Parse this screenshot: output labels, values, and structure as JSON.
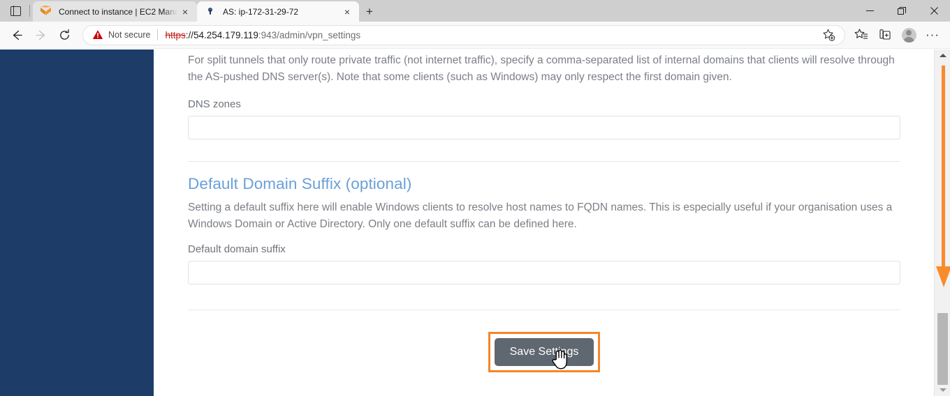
{
  "browser": {
    "tablist_icon": "tab-list-icon",
    "tabs": [
      {
        "favicon": "aws-cube-icon",
        "title": "Connect to instance | EC2 Manag",
        "close_label": "×",
        "active": false
      },
      {
        "favicon": "openvpn-icon",
        "title": "AS: ip-172-31-29-72",
        "close_label": "×",
        "active": true
      }
    ],
    "newtab_label": "+",
    "window_controls": {
      "minimize": "–",
      "maximize": "❐",
      "close": "✕"
    },
    "nav": {
      "back": "←",
      "forward": "→",
      "reload": "↻"
    },
    "omnibox": {
      "security_icon": "not-secure-warning-icon",
      "security_label": "Not secure",
      "url_scheme": "https",
      "url_host": "://54.254.179.119",
      "url_rest": ":943/admin/vpn_settings"
    },
    "toolbar_icons": {
      "add_favorite": "add-favorite-star-icon",
      "favorites": "favorites-list-icon",
      "collections": "collections-icon",
      "profile": "profile-avatar-icon",
      "settings": "···"
    }
  },
  "page": {
    "dns_zones": {
      "description": "For split tunnels that only route private traffic (not internet traffic), specify a comma-separated list of internal domains that clients will resolve through the AS-pushed DNS server(s). Note that some clients (such as Windows) may only respect the first domain given.",
      "label": "DNS zones",
      "value": "",
      "placeholder": ""
    },
    "default_domain_suffix": {
      "heading": "Default Domain Suffix (optional)",
      "description": "Setting a default suffix here will enable Windows clients to resolve host names to FQDN names. This is especially useful if your organisation uses a Windows Domain or Active Directory. Only one default suffix can be defined here.",
      "label": "Default domain suffix",
      "value": "",
      "placeholder": ""
    },
    "save_button": "Save Settings"
  },
  "scrollbar": {
    "up_arrow": "scroll-up-arrow-icon",
    "down_arrow": "scroll-down-arrow-icon"
  },
  "annotations": {
    "scroll_hint_arrow": "orange-down-arrow-annotation",
    "save_highlight": "orange-highlight-box",
    "highlight_color": "#f5862a"
  },
  "colors": {
    "sidebar": "#1d3c68",
    "heading": "#6aa0d8",
    "save_button_bg": "#5f6770",
    "accent_orange": "#f5862a"
  }
}
